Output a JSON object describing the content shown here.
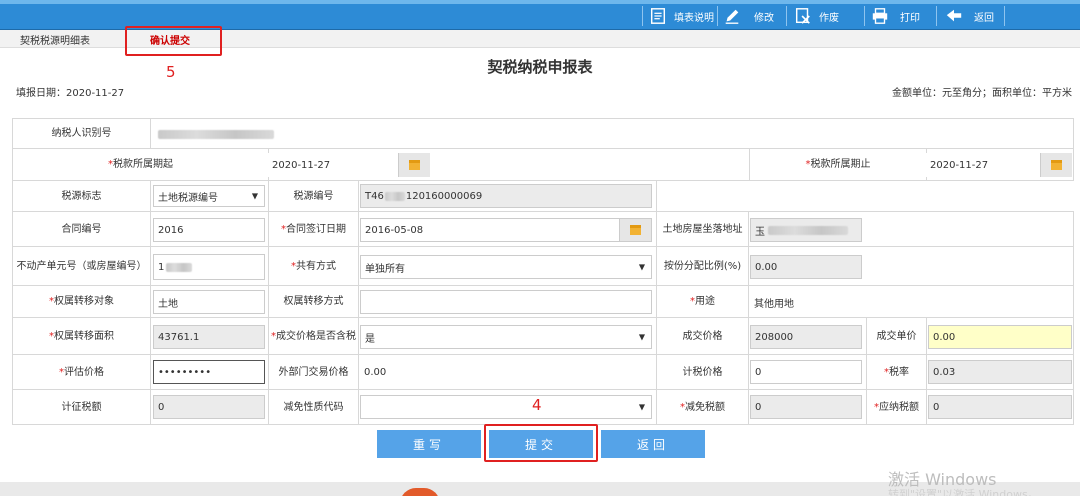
{
  "toolbar": {
    "fill_help": "填表说明",
    "edit": "修改",
    "void": "作废",
    "print": "打印",
    "back": "返回"
  },
  "tabs": {
    "detail": "契税税源明细表",
    "confirm": "确认提交"
  },
  "annotations": {
    "step5": "5",
    "step4": "4"
  },
  "form": {
    "title": "契税纳税申报表",
    "fill_date": "填报日期：2020-11-27",
    "units": "金额单位：元至角分；面积单位：平方米",
    "taxpayer_id_label": "纳税人识别号",
    "period_start_label": "税款所属期起",
    "period_start_value": "2020-11-27",
    "period_end_label": "税款所属期止",
    "period_end_value": "2020-11-27",
    "source_flag_label": "税源标志",
    "source_flag_value": "土地税源编号",
    "source_no_label": "税源编号",
    "source_no_prefix": "T46",
    "source_no_suffix": "120160000069",
    "contract_no_label": "合同编号",
    "contract_no_value": "2016",
    "contract_date_label": "合同签订日期",
    "contract_date_value": "2016-05-08",
    "address_label": "土地房屋坐落地址",
    "address_prefix": "玉",
    "property_unit_label": "不动产单元号（或房屋编号）",
    "property_unit_prefix": "1",
    "share_mode_label": "共有方式",
    "share_mode_value": "单独所有",
    "ratio_label": "按份分配比例(%)",
    "ratio_value": "0.00",
    "transfer_obj_label": "权属转移对象",
    "transfer_obj_value": "土地",
    "transfer_mode_label": "权属转移方式",
    "transfer_mode_value": "",
    "usage_label": "用途",
    "usage_value": "其他用地",
    "area_label": "权属转移面积",
    "area_value": "43761.1",
    "price_tax_incl_label": "成交价格是否含税",
    "price_tax_incl_value": "是",
    "deal_price_label": "成交价格",
    "deal_price_value": "208000",
    "unit_price_label": "成交单价",
    "unit_price_value": "0.00",
    "assess_price_label": "评估价格",
    "assess_price_value": "•••••••••",
    "ext_price_label": "外部门交易价格",
    "ext_price_value": "0.00",
    "tax_price_label": "计税价格",
    "tax_price_value": "0",
    "tax_rate_label": "税率",
    "tax_rate_value": "0.03",
    "levy_tax_label": "计征税额",
    "levy_tax_value": "0",
    "relief_code_label": "减免性质代码",
    "relief_code_value": "",
    "relief_tax_label": "减免税额",
    "relief_tax_value": "0",
    "payable_label": "应纳税额",
    "payable_value": "0"
  },
  "buttons": {
    "reset": "重写",
    "submit": "提交",
    "back": "返回"
  },
  "watermark": {
    "line1": "激活 Windows",
    "line2": "转到\"设置\"以激活 Windows。"
  }
}
